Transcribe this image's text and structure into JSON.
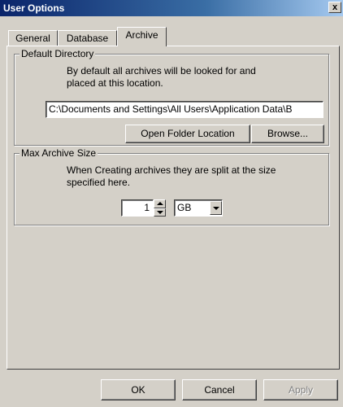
{
  "window": {
    "title": "User Options",
    "close_glyph": "x"
  },
  "tabs": [
    {
      "label": "General"
    },
    {
      "label": "Database"
    },
    {
      "label": "Archive"
    }
  ],
  "default_directory": {
    "legend": "Default Directory",
    "description_line1": "By default all archives will be looked for and",
    "description_line2": "placed at this location.",
    "path_value": "C:\\Documents and Settings\\All Users\\Application Data\\B",
    "open_folder_label": "Open Folder Location",
    "browse_label": "Browse..."
  },
  "max_archive_size": {
    "legend": "Max Archive Size",
    "description_line1": "When Creating archives they are split at the size",
    "description_line2": "specified here.",
    "size_value": "1",
    "unit_value": "GB"
  },
  "footer": {
    "ok_label": "OK",
    "cancel_label": "Cancel",
    "apply_label": "Apply"
  }
}
